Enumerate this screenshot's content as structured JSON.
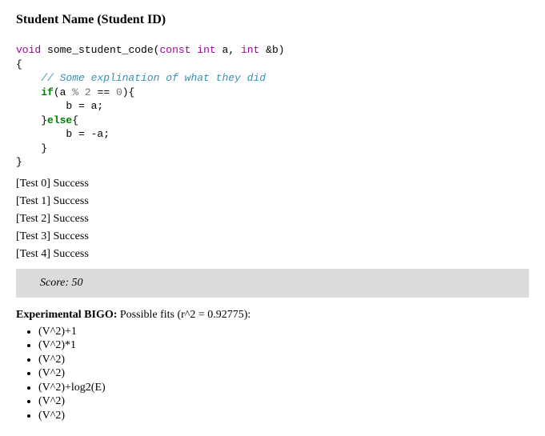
{
  "heading": "Student Name (Student ID)",
  "code": {
    "kw_void": "void",
    "fn_name": "some_student_code",
    "kw_const": "const",
    "kw_int1": "int",
    "param_a": "a",
    "kw_int2": "int",
    "param_b": "&b",
    "comment": "// Some explination of what they did",
    "kw_if": "if",
    "cond_a": "a",
    "cond_pct": "%",
    "cond_two": "2",
    "cond_eq": "==",
    "cond_zero": "0",
    "stmt1": "b = a;",
    "kw_else": "else",
    "stmt2": "b = -a;"
  },
  "tests": [
    {
      "label": "[Test 0]",
      "result": "Success"
    },
    {
      "label": "[Test 1]",
      "result": "Success"
    },
    {
      "label": "[Test 2]",
      "result": "Success"
    },
    {
      "label": "[Test 3]",
      "result": "Success"
    },
    {
      "label": "[Test 4]",
      "result": "Success"
    }
  ],
  "score": "Score: 50",
  "bigo": {
    "label": "Experimental BIGO:",
    "suffix": " Possible fits (r^2 = 0.92775):"
  },
  "fits": [
    "(V^2)+1",
    "(V^2)*1",
    "(V^2)",
    "(V^2)",
    "(V^2)+log2(E)",
    "(V^2)",
    "(V^2)"
  ]
}
